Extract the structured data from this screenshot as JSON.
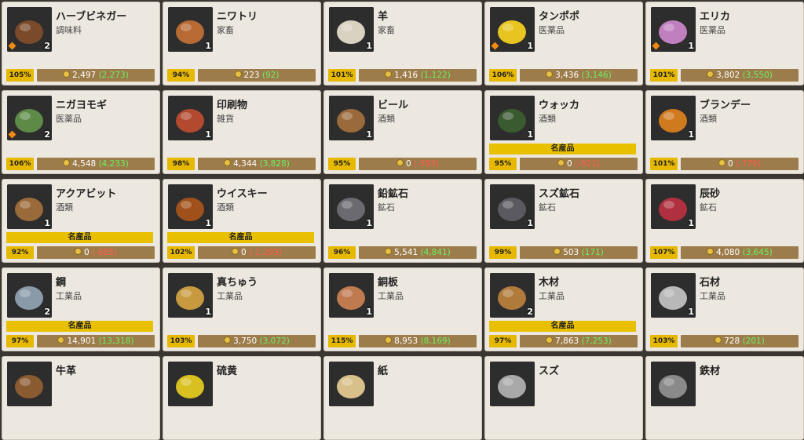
{
  "cards": [
    {
      "name": "ハーブビネガー",
      "category": "調味料",
      "qty": "2",
      "pct": "105%",
      "price": "2,497",
      "diff": "(2,273)",
      "trend": "up",
      "special": "",
      "badge": true,
      "icon": "herb-vinegar-icon",
      "color": "#7a4a2a"
    },
    {
      "name": "ニワトリ",
      "category": "家畜",
      "qty": "1",
      "pct": "94%",
      "price": "223",
      "diff": "(92)",
      "trend": "up",
      "special": "",
      "badge": false,
      "icon": "chicken-icon",
      "color": "#b86a35"
    },
    {
      "name": "羊",
      "category": "家畜",
      "qty": "1",
      "pct": "101%",
      "price": "1,416",
      "diff": "(1,122)",
      "trend": "up",
      "special": "",
      "badge": false,
      "icon": "sheep-icon",
      "color": "#d8d2c0"
    },
    {
      "name": "タンポポ",
      "category": "医薬品",
      "qty": "1",
      "pct": "106%",
      "price": "3,436",
      "diff": "(3,146)",
      "trend": "up",
      "special": "",
      "badge": true,
      "icon": "dandelion-icon",
      "color": "#e8c420"
    },
    {
      "name": "エリカ",
      "category": "医薬品",
      "qty": "1",
      "pct": "101%",
      "price": "3,802",
      "diff": "(3,550)",
      "trend": "up",
      "special": "",
      "badge": true,
      "icon": "erica-icon",
      "color": "#c080c0"
    },
    {
      "name": "ニガヨモギ",
      "category": "医薬品",
      "qty": "2",
      "pct": "106%",
      "price": "4,548",
      "diff": "(4,233)",
      "trend": "up",
      "special": "",
      "badge": true,
      "icon": "wormwood-icon",
      "color": "#5e8a48"
    },
    {
      "name": "印刷物",
      "category": "雑貨",
      "qty": "1",
      "pct": "98%",
      "price": "4,344",
      "diff": "(3,828)",
      "trend": "up",
      "special": "",
      "badge": false,
      "icon": "book-icon",
      "color": "#b34a30"
    },
    {
      "name": "ビール",
      "category": "酒類",
      "qty": "1",
      "pct": "95%",
      "price": "0",
      "diff": "(-583)",
      "trend": "down",
      "special": "",
      "badge": false,
      "icon": "beer-mug-icon",
      "color": "#9a6a3a"
    },
    {
      "name": "ウォッカ",
      "category": "酒類",
      "qty": "1",
      "pct": "95%",
      "price": "0",
      "diff": "(-921)",
      "trend": "down",
      "special": "名産品",
      "badge": false,
      "icon": "vodka-bottle-icon",
      "color": "#3a5a30"
    },
    {
      "name": "ブランデー",
      "category": "酒類",
      "qty": "1",
      "pct": "101%",
      "price": "0",
      "diff": "(-770)",
      "trend": "down",
      "special": "",
      "badge": false,
      "icon": "brandy-icon",
      "color": "#d07a20"
    },
    {
      "name": "アクアビット",
      "category": "酒類",
      "qty": "1",
      "pct": "92%",
      "price": "0",
      "diff": "(-885)",
      "trend": "down",
      "special": "名産品",
      "badge": false,
      "icon": "barrel-icon",
      "color": "#9a6a3a"
    },
    {
      "name": "ウイスキー",
      "category": "酒類",
      "qty": "1",
      "pct": "102%",
      "price": "0",
      "diff": "(-1,293)",
      "trend": "down",
      "special": "名産品",
      "badge": false,
      "icon": "whisky-icon",
      "color": "#a0501a"
    },
    {
      "name": "鉛鉱石",
      "category": "鉱石",
      "qty": "1",
      "pct": "96%",
      "price": "5,541",
      "diff": "(4,841)",
      "trend": "up",
      "special": "",
      "badge": false,
      "icon": "lead-ore-icon",
      "color": "#6a6a70"
    },
    {
      "name": "スズ鉱石",
      "category": "鉱石",
      "qty": "1",
      "pct": "99%",
      "price": "503",
      "diff": "(171)",
      "trend": "up",
      "special": "",
      "badge": false,
      "icon": "tin-ore-icon",
      "color": "#5a5a60"
    },
    {
      "name": "辰砂",
      "category": "鉱石",
      "qty": "1",
      "pct": "107%",
      "price": "4,080",
      "diff": "(3,645)",
      "trend": "up",
      "special": "",
      "badge": false,
      "icon": "cinnabar-icon",
      "color": "#b03040"
    },
    {
      "name": "鋼",
      "category": "工業品",
      "qty": "2",
      "pct": "97%",
      "price": "14,901",
      "diff": "(13,318)",
      "trend": "up",
      "special": "名産品",
      "badge": false,
      "icon": "steel-icon",
      "color": "#8a9aa8"
    },
    {
      "name": "真ちゅう",
      "category": "工業品",
      "qty": "1",
      "pct": "103%",
      "price": "3,750",
      "diff": "(3,072)",
      "trend": "up",
      "special": "",
      "badge": false,
      "icon": "brass-ingot-icon",
      "color": "#c89a40"
    },
    {
      "name": "銅板",
      "category": "工業品",
      "qty": "1",
      "pct": "115%",
      "price": "8,953",
      "diff": "(8,169)",
      "trend": "up",
      "special": "",
      "badge": false,
      "icon": "copper-plate-icon",
      "color": "#c07a50"
    },
    {
      "name": "木材",
      "category": "工業品",
      "qty": "2",
      "pct": "97%",
      "price": "7,863",
      "diff": "(7,253)",
      "trend": "up",
      "special": "名産品",
      "badge": false,
      "icon": "timber-icon",
      "color": "#b07a3a"
    },
    {
      "name": "石材",
      "category": "工業品",
      "qty": "1",
      "pct": "103%",
      "price": "728",
      "diff": "(201)",
      "trend": "up",
      "special": "",
      "badge": false,
      "icon": "stone-block-icon",
      "color": "#b8b8b8"
    },
    {
      "name": "牛革",
      "category": "",
      "qty": "",
      "pct": "",
      "price": "",
      "diff": "",
      "trend": "up",
      "special": "",
      "badge": false,
      "icon": "leather-icon",
      "color": "#8a5a30"
    },
    {
      "name": "硫黄",
      "category": "",
      "qty": "",
      "pct": "",
      "price": "",
      "diff": "",
      "trend": "up",
      "special": "",
      "badge": false,
      "icon": "sulfur-icon",
      "color": "#d8c020"
    },
    {
      "name": "紙",
      "category": "",
      "qty": "",
      "pct": "",
      "price": "",
      "diff": "",
      "trend": "up",
      "special": "",
      "badge": false,
      "icon": "paper-icon",
      "color": "#d8c08a"
    },
    {
      "name": "スズ",
      "category": "",
      "qty": "",
      "pct": "",
      "price": "",
      "diff": "",
      "trend": "up",
      "special": "",
      "badge": false,
      "icon": "tin-ingot-icon",
      "color": "#a8a8a8"
    },
    {
      "name": "鉄材",
      "category": "",
      "qty": "",
      "pct": "",
      "price": "",
      "diff": "",
      "trend": "up",
      "special": "",
      "badge": false,
      "icon": "iron-icon",
      "color": "#8a8a8a"
    }
  ]
}
